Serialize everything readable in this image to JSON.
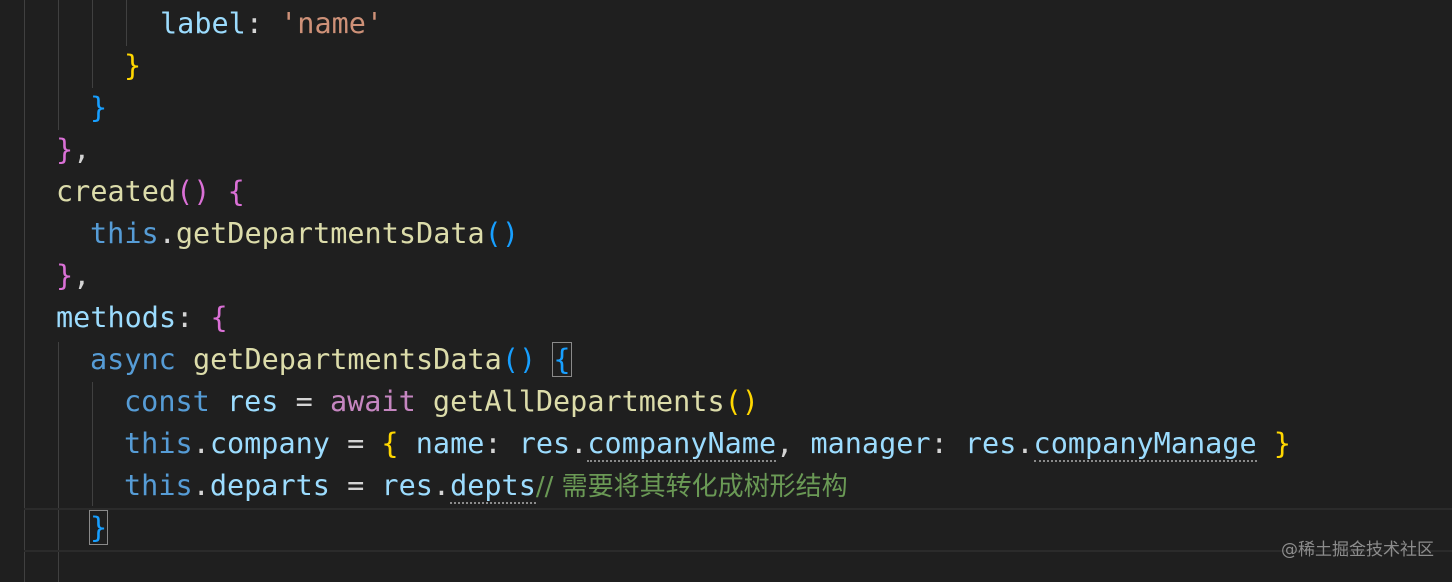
{
  "code": {
    "l1": {
      "key": "label",
      "colon": ": ",
      "value": "'name'"
    },
    "l2": {
      "brace": "}"
    },
    "l3": {
      "brace": "}"
    },
    "l4": {
      "brace": "}",
      "comma": ","
    },
    "l5": {
      "name": "created",
      "paren_open": "(",
      "paren_close": ")",
      "space": " ",
      "brace": "{"
    },
    "l6": {
      "this": "this",
      "dot": ".",
      "method": "getDepartmentsData",
      "paren_open": "(",
      "paren_close": ")"
    },
    "l7": {
      "brace": "}",
      "comma": ","
    },
    "l8": {
      "key": "methods",
      "colon": ": ",
      "brace": "{"
    },
    "l9": {
      "async": "async",
      "space1": " ",
      "method": "getDepartmentsData",
      "parens": "()",
      "space2": " ",
      "brace": "{"
    },
    "l10": {
      "const": "const",
      "sp1": " ",
      "var": "res",
      "eq": " = ",
      "await": "await",
      "sp2": " ",
      "fn": "getAllDepartments",
      "paren_open": "(",
      "paren_close": ")"
    },
    "l11": {
      "this": "this",
      "dot1": ".",
      "prop": "company",
      "eq": " = ",
      "brace_open": "{",
      "sp1": " ",
      "k1": "name",
      "c1": ": ",
      "r1": "res",
      "d1": ".",
      "v1": "companyName",
      "comma": ", ",
      "k2": "manager",
      "c2": ": ",
      "r2": "res",
      "d2": ".",
      "v2": "companyManage",
      "sp2": " ",
      "brace_close": "}"
    },
    "l12": {
      "this": "this",
      "dot1": ".",
      "prop": "departs",
      "eq": " = ",
      "r": "res",
      "d": ".",
      "v": "depts",
      "comment": "// 需要将其转化成树形结构"
    },
    "l13": {
      "brace": "}"
    }
  },
  "watermark": "@稀土掘金技术社区",
  "colors": {
    "background": "#1f1f1f",
    "keyword_blue": "#569cd6",
    "keyword_purple": "#c586c0",
    "property": "#9cdcfe",
    "function": "#dcdcaa",
    "string": "#ce9178",
    "comment": "#6a9955",
    "bracket_gold": "#ffd700",
    "bracket_orchid": "#da70d6",
    "bracket_blue": "#179fff"
  }
}
